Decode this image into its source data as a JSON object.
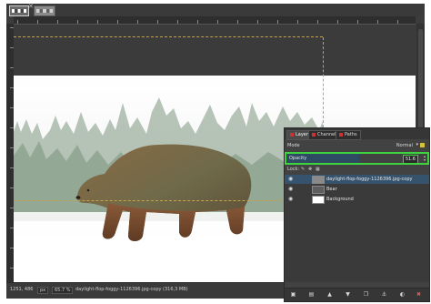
{
  "image_tabs": [
    {
      "name": "image-tab-1",
      "active": true
    },
    {
      "name": "image-tab-2",
      "active": false
    }
  ],
  "status": {
    "coords": "1251, 486",
    "unit": "px",
    "zoom": "65.7 %",
    "info": "daylight-flop-foggy-1126396.jpg-copy (316,3 MB)"
  },
  "dock": {
    "tabs": [
      "Layers",
      "Channels",
      "Paths"
    ],
    "mode_label": "Mode",
    "mode_value": "Normal",
    "opacity_label": "Opacity",
    "opacity_value": "51.6",
    "opacity_fraction": 0.516,
    "lock_label": "Lock:",
    "layers": [
      {
        "name": "daylight-flop-foggy-1126396.jpg-copy",
        "selected": true
      },
      {
        "name": "Bear",
        "selected": false
      },
      {
        "name": "Background",
        "selected": false
      }
    ]
  },
  "colors": {
    "highlight": "#3fd23f",
    "guide": "#c8a24a",
    "selected_layer": "#36536d",
    "bear": "#6b5236"
  }
}
